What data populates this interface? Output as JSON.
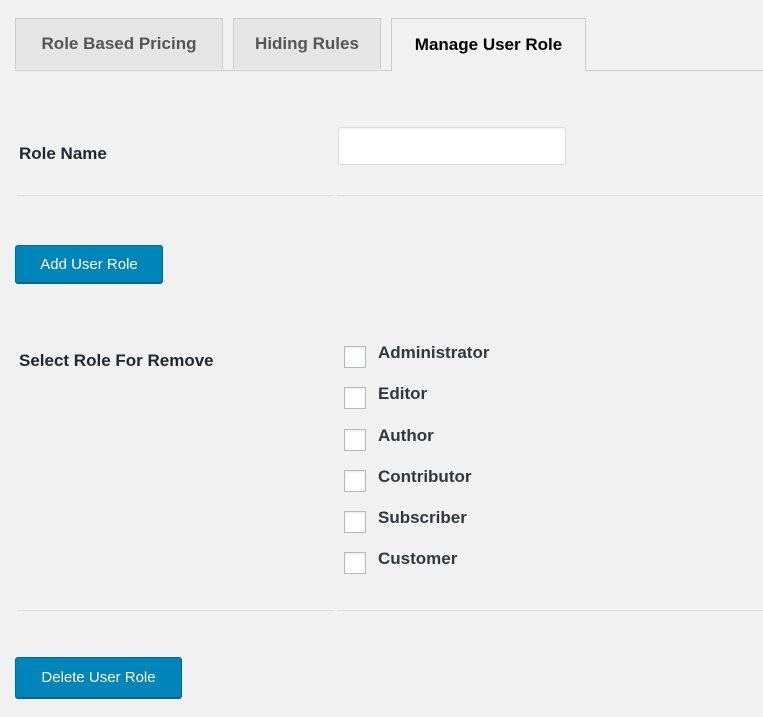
{
  "tabs": [
    {
      "label": "Role Based Pricing",
      "active": false
    },
    {
      "label": "Hiding Rules",
      "active": false
    },
    {
      "label": "Manage User Role",
      "active": true
    }
  ],
  "form": {
    "role_name_label": "Role Name",
    "role_name_value": "",
    "add_button_label": "Add User Role",
    "remove_label": "Select Role For Remove",
    "roles": [
      "Administrator",
      "Editor",
      "Author",
      "Contributor",
      "Subscriber",
      "Customer"
    ],
    "delete_button_label": "Delete User Role"
  },
  "colors": {
    "primary_button": "#0085ba",
    "background": "#f1f1f1"
  }
}
